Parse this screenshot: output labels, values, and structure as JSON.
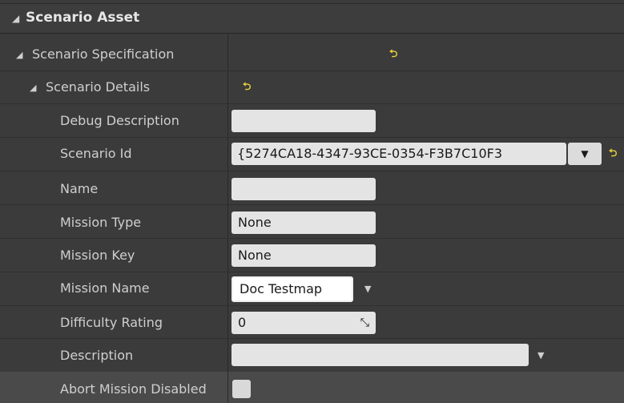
{
  "panel": {
    "title": "Scenario Asset",
    "reset_glyph": "⮌"
  },
  "sections": {
    "spec_label": "Scenario Specification",
    "details_label": "Scenario Details"
  },
  "properties": {
    "debug_description": {
      "label": "Debug Description",
      "value": ""
    },
    "scenario_id": {
      "label": "Scenario Id",
      "value": "{5274CA18-4347-93CE-0354-F3B7C10F3"
    },
    "name": {
      "label": "Name",
      "value": ""
    },
    "mission_type": {
      "label": "Mission Type",
      "value": "None"
    },
    "mission_key": {
      "label": "Mission Key",
      "value": "None"
    },
    "mission_name": {
      "label": "Mission Name",
      "value": "Doc Testmap"
    },
    "difficulty_rating": {
      "label": "Difficulty Rating",
      "value": "0"
    },
    "description": {
      "label": "Description",
      "value": ""
    },
    "abort_mission_disabled": {
      "label": "Abort Mission Disabled",
      "checked": false
    }
  }
}
